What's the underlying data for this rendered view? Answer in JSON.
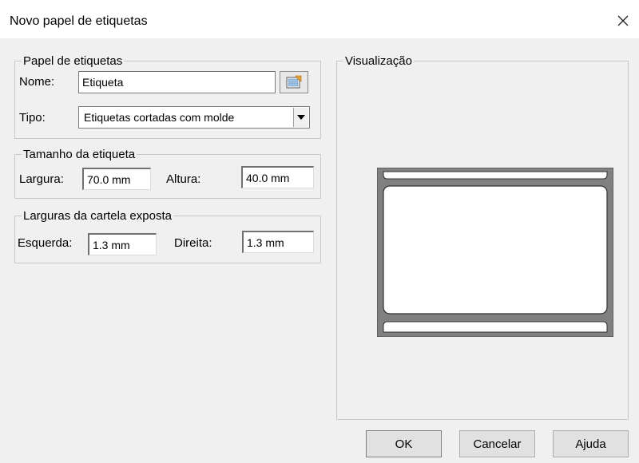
{
  "window": {
    "title": "Novo papel de etiquetas",
    "close_icon": "close-icon"
  },
  "paper_group": {
    "legend": "Papel de etiquetas",
    "name_label": "Nome:",
    "name_value": "Etiqueta",
    "browse_icon": "label-paper-browse-icon",
    "type_label": "Tipo:",
    "type_value": "Etiquetas cortadas com molde"
  },
  "size_group": {
    "legend": "Tamanho da etiqueta",
    "width_label": "Largura:",
    "width_value": "70.0 mm",
    "height_label": "Altura:",
    "height_value": "40.0 mm"
  },
  "liner_group": {
    "legend": "Larguras da cartela exposta",
    "left_label": "Esquerda:",
    "left_value": "1.3 mm",
    "right_label": "Direita:",
    "right_value": "1.3 mm"
  },
  "preview_group": {
    "legend": "Visualização"
  },
  "buttons": {
    "ok": "OK",
    "cancel": "Cancelar",
    "help": "Ajuda"
  }
}
